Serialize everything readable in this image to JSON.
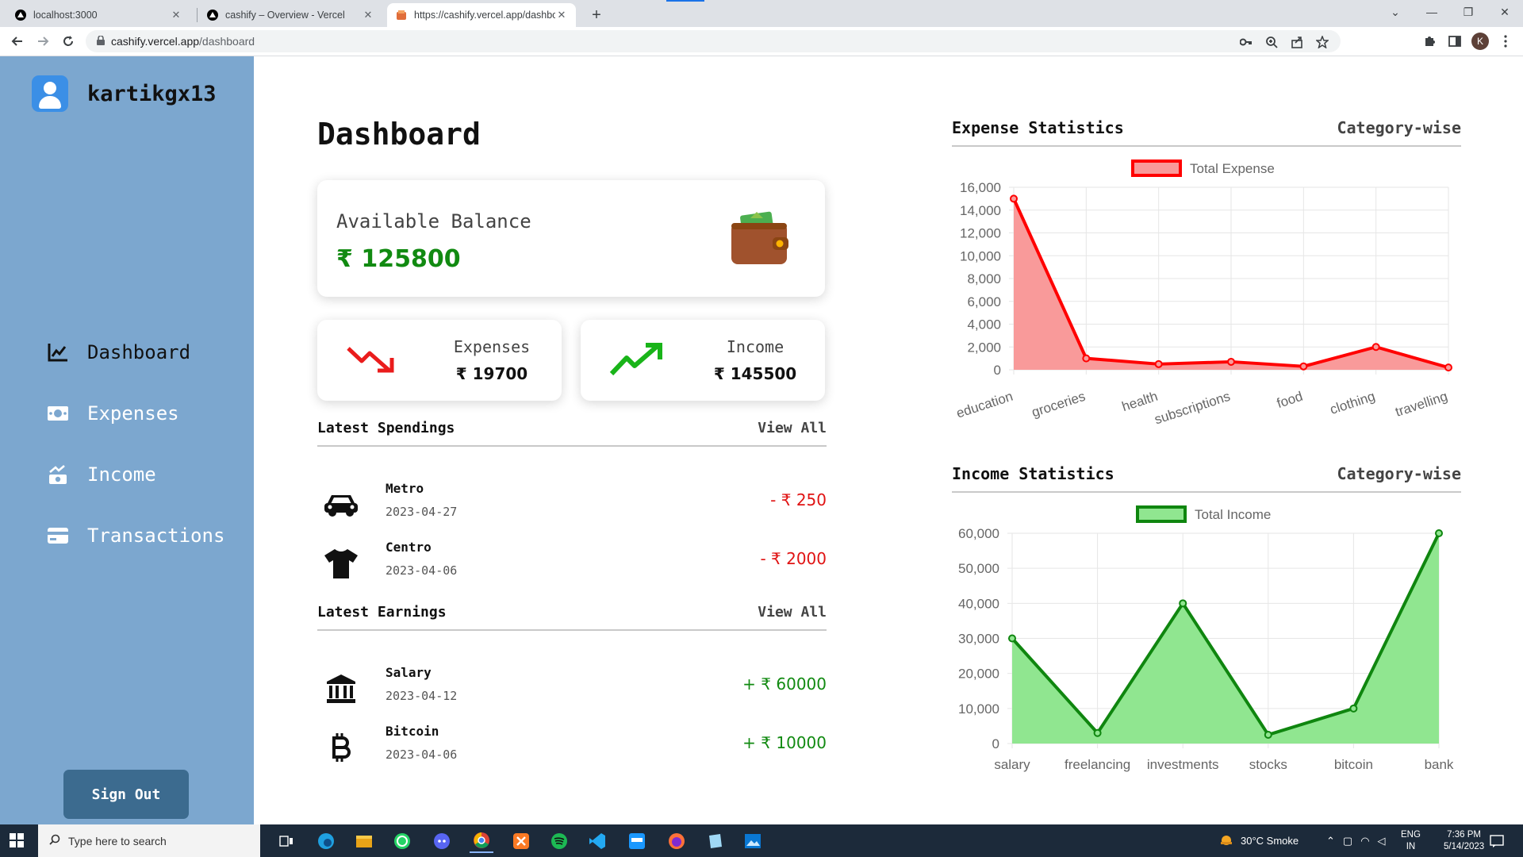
{
  "browser": {
    "tabs": [
      {
        "title": "localhost:3000"
      },
      {
        "title": "cashify – Overview - Vercel"
      },
      {
        "title": "https://cashify.vercel.app/dashbo"
      }
    ],
    "url_host": "cashify.vercel.app",
    "url_path": "/dashboard",
    "profile_initial": "K"
  },
  "sidebar": {
    "username": "kartikgx13",
    "items": [
      {
        "label": "Dashboard",
        "icon": "chart-line-icon"
      },
      {
        "label": "Expenses",
        "icon": "cash-icon"
      },
      {
        "label": "Income",
        "icon": "money-growth-icon"
      },
      {
        "label": "Transactions",
        "icon": "credit-card-icon"
      }
    ],
    "signout_label": "Sign Out"
  },
  "main": {
    "title": "Dashboard",
    "balance": {
      "label": "Available Balance",
      "value": "₹ 125800"
    },
    "expenses": {
      "label": "Expenses",
      "value": "₹ 19700"
    },
    "income": {
      "label": "Income",
      "value": "₹ 145500"
    },
    "latest_spendings": {
      "title": "Latest Spendings",
      "view_all": "View All",
      "items": [
        {
          "name": "Metro",
          "date": "2023-04-27",
          "amount": "- ₹ 250",
          "icon": "car-icon"
        },
        {
          "name": "Centro",
          "date": "2023-04-06",
          "amount": "- ₹ 2000",
          "icon": "tshirt-icon"
        }
      ]
    },
    "latest_earnings": {
      "title": "Latest Earnings",
      "view_all": "View All",
      "items": [
        {
          "name": "Salary",
          "date": "2023-04-12",
          "amount": "+ ₹ 60000",
          "icon": "bank-icon"
        },
        {
          "name": "Bitcoin",
          "date": "2023-04-06",
          "amount": "+ ₹ 10000",
          "icon": "bitcoin-icon"
        }
      ]
    }
  },
  "charts_header": {
    "expense": {
      "title": "Expense Statistics",
      "subtitle": "Category-wise"
    },
    "income": {
      "title": "Income Statistics",
      "subtitle": "Category-wise"
    }
  },
  "chart_data": [
    {
      "type": "area",
      "title": "Expense Statistics",
      "subtitle": "Category-wise",
      "categories": [
        "education",
        "groceries",
        "health",
        "subscriptions",
        "food",
        "clothing",
        "travelling"
      ],
      "series": [
        {
          "name": "Total Expense",
          "values": [
            15000,
            1000,
            500,
            700,
            300,
            2000,
            200
          ]
        }
      ],
      "y_ticks": [
        "0",
        "2,000",
        "4,000",
        "6,000",
        "8,000",
        "10,000",
        "12,000",
        "14,000",
        "16,000"
      ],
      "ylim": [
        0,
        16000
      ],
      "line_color": "#ff0000",
      "fill_color": "#f99a9a",
      "legend": "top-center",
      "grid": true
    },
    {
      "type": "area",
      "title": "Income Statistics",
      "subtitle": "Category-wise",
      "categories": [
        "salary",
        "freelancing",
        "investments",
        "stocks",
        "bitcoin",
        "bank"
      ],
      "series": [
        {
          "name": "Total Income",
          "values": [
            30000,
            3000,
            40000,
            2500,
            10000,
            60000
          ]
        }
      ],
      "y_ticks": [
        "0",
        "10,000",
        "20,000",
        "30,000",
        "40,000",
        "50,000",
        "60,000"
      ],
      "ylim": [
        0,
        60000
      ],
      "line_color": "#0f860f",
      "fill_color": "#90e690",
      "legend": "top-center",
      "grid": true
    }
  ],
  "taskbar": {
    "search_placeholder": "Type here to search",
    "weather": "30°C  Smoke",
    "lang_top": "ENG",
    "lang_bottom": "IN",
    "time": "7:36 PM",
    "date": "5/14/2023"
  }
}
